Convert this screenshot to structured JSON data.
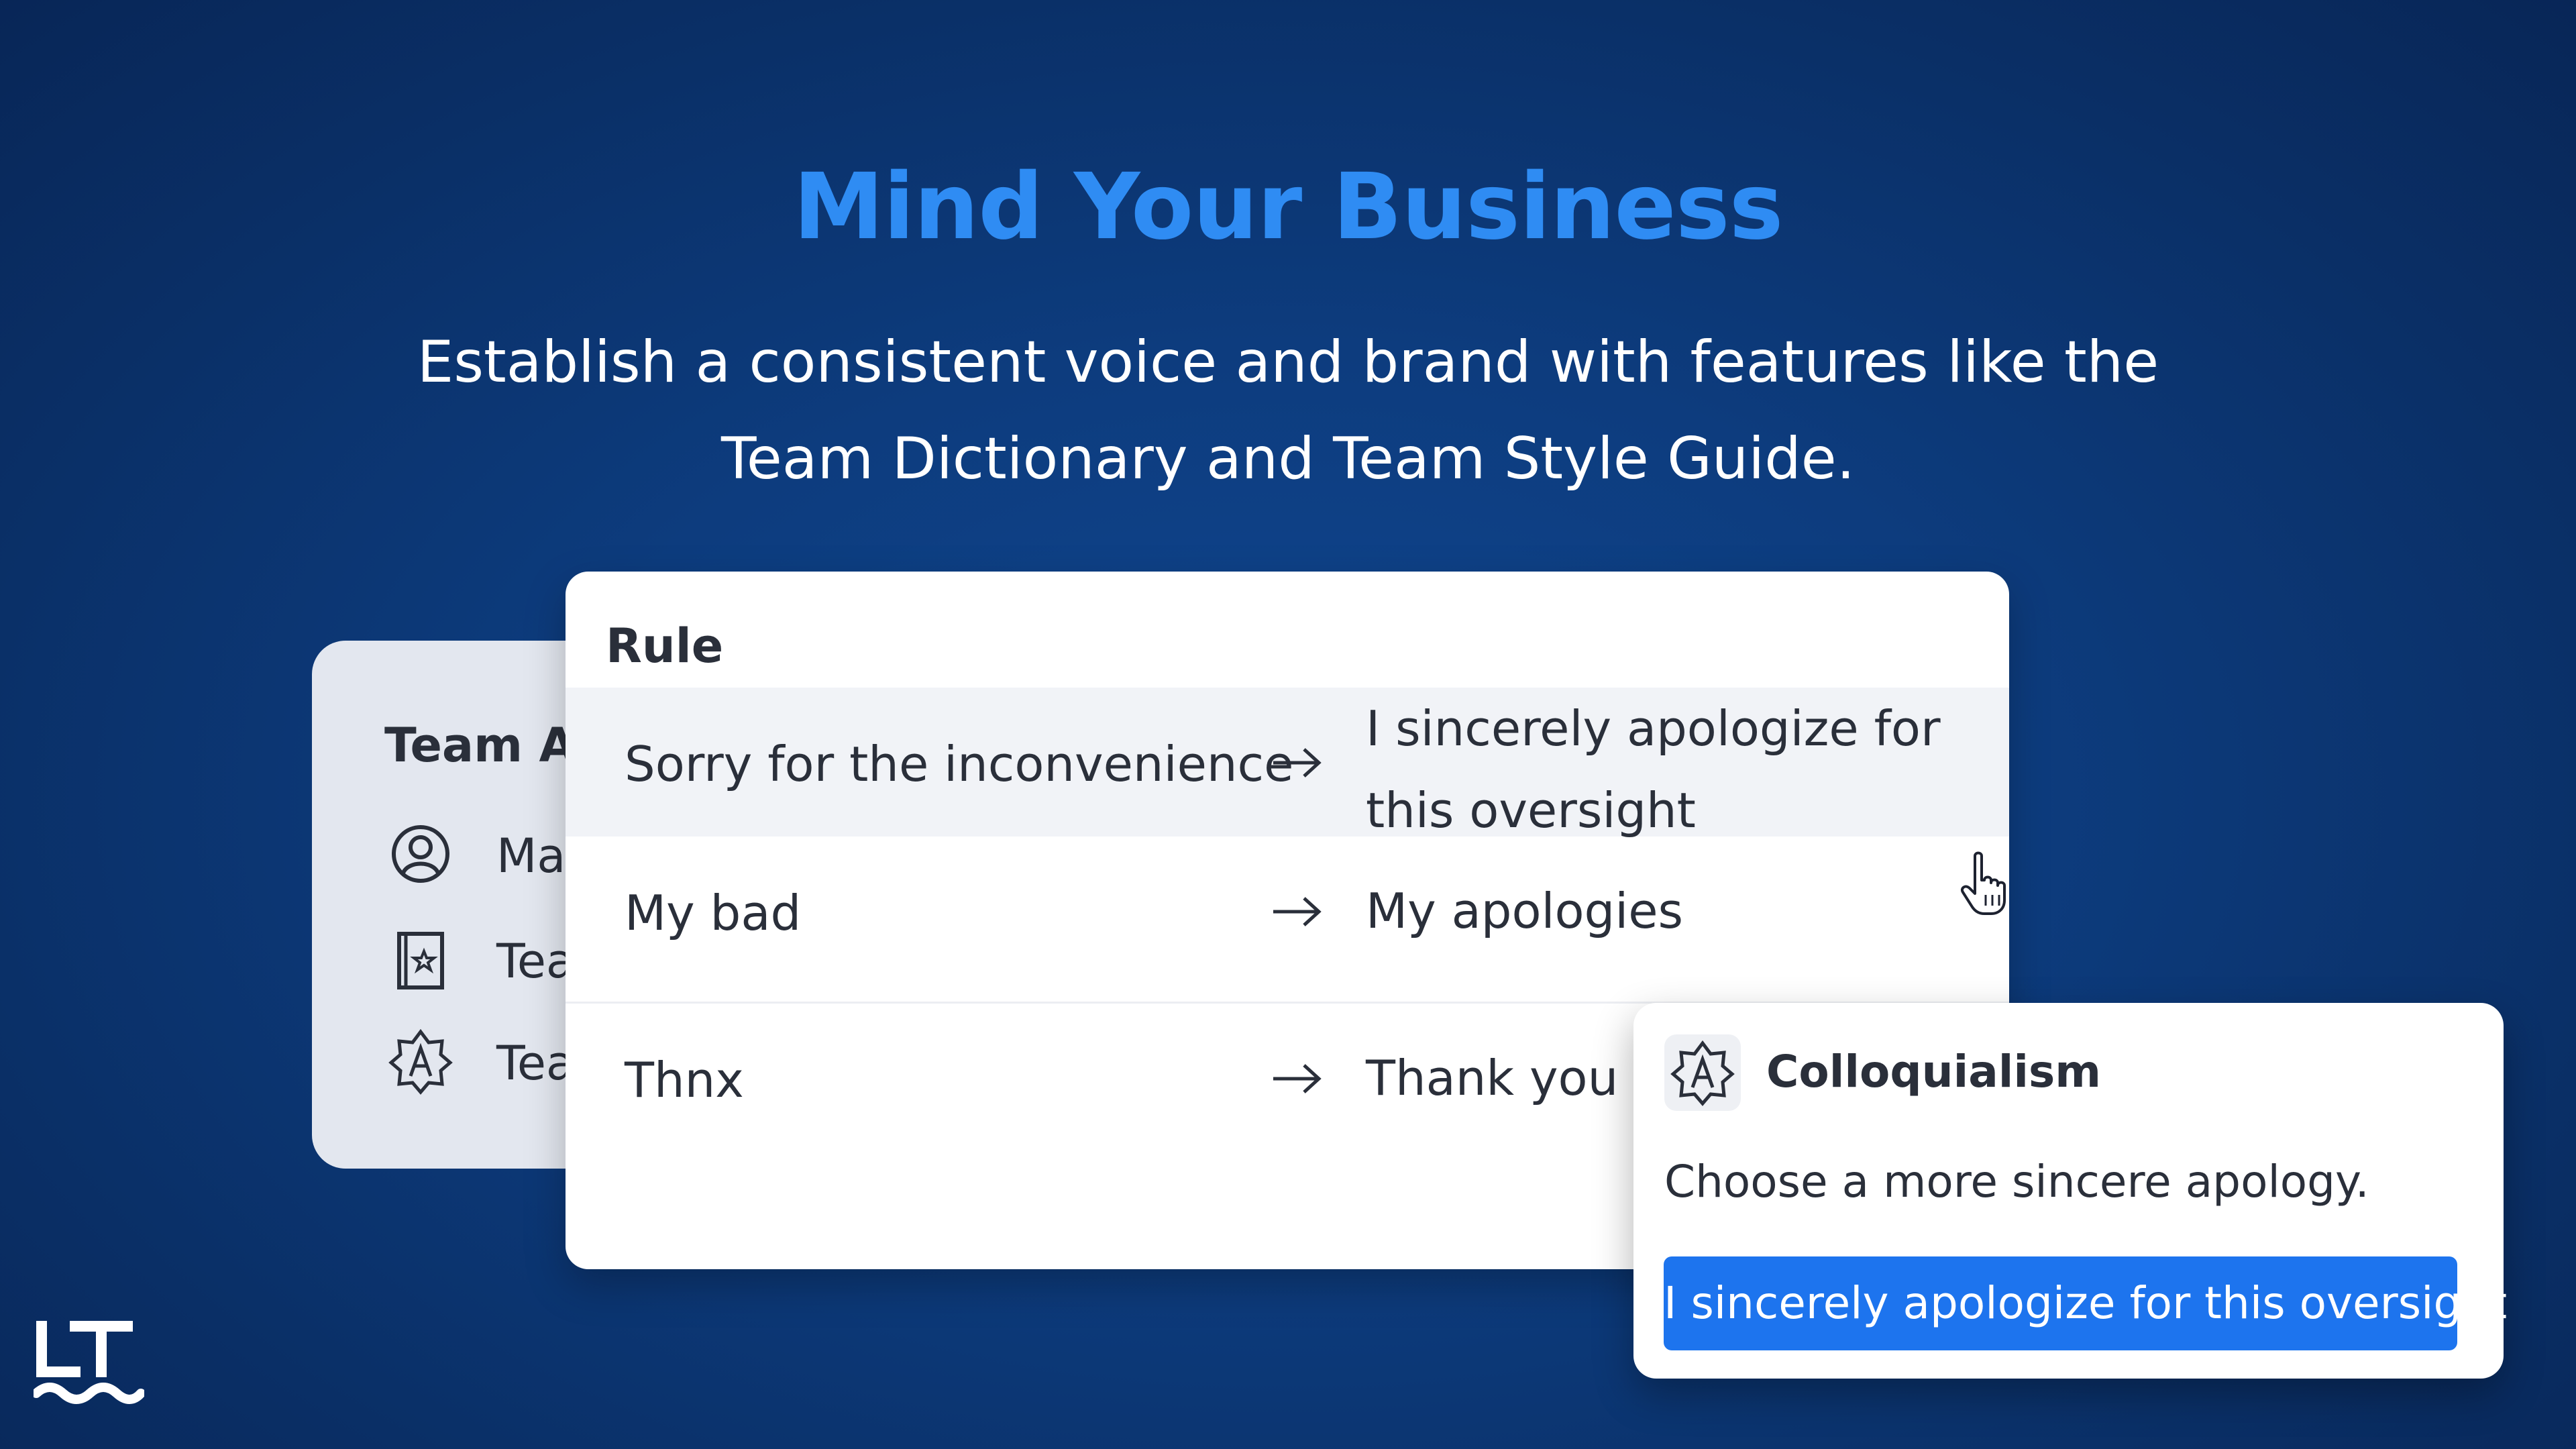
{
  "header": {
    "title": "Mind Your Business",
    "subtitle": "Establish a consistent voice and brand with features like the Team Dictionary and Team Style Guide."
  },
  "back_card": {
    "heading": "Team Ac",
    "items": [
      {
        "label": "Mar",
        "icon": "user-circle-icon"
      },
      {
        "label": "Tear",
        "icon": "book-star-icon"
      },
      {
        "label": "Tear",
        "icon": "style-badge-icon"
      }
    ]
  },
  "rules": {
    "header": "Rule",
    "rows": [
      {
        "from": "Sorry for the inconvenience",
        "to": "I sincerely apologize for this oversight"
      },
      {
        "from": "My bad",
        "to": "My apologies"
      },
      {
        "from": "Thnx",
        "to": "Thank you"
      }
    ]
  },
  "popup": {
    "icon": "style-badge-icon",
    "title": "Colloquialism",
    "message": "Choose a more sincere apology.",
    "suggestion": "I sincerely apologize for this oversight"
  },
  "colors": {
    "accent": "#2f8cf3",
    "button": "#1d74ee",
    "background": "#0d3c7e"
  }
}
